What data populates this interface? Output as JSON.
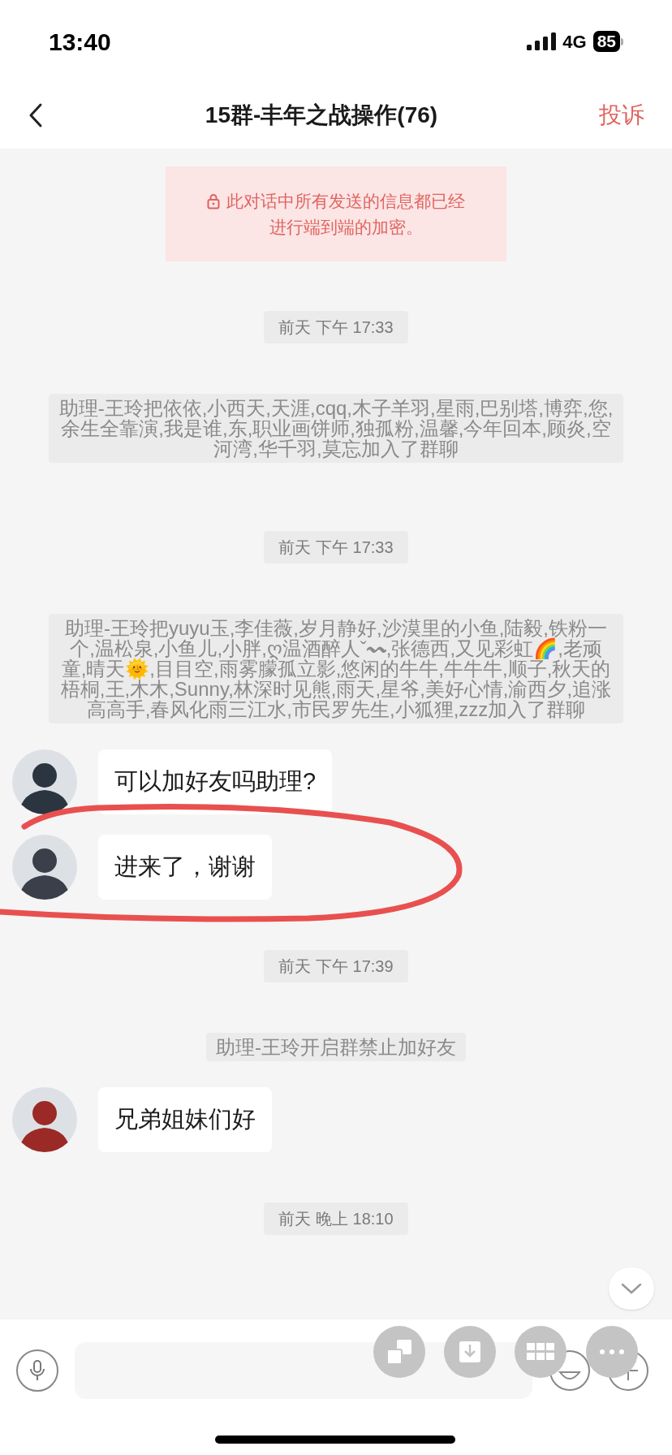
{
  "status_bar": {
    "time": "13:40",
    "network": "4G",
    "battery": "85"
  },
  "header": {
    "title": "15群-丰年之战操作(76)",
    "action": "投诉"
  },
  "messages": [
    {
      "kind": "notice",
      "lines": [
        "此对话中所有发送的信息都已经",
        "进行端到端的加密。"
      ]
    },
    {
      "kind": "timestamp",
      "text": "前天 下午 17:33"
    },
    {
      "kind": "system",
      "text": "助理-王玲把依依,小西天,天涯,cqq,木子羊羽,星雨,巴别塔,博弈,您,余生全靠演,我是谁,东,职业画饼师,独孤粉,温馨,今年回本,顾炎,空河湾,华千羽,莫忘加入了群聊"
    },
    {
      "kind": "timestamp",
      "text": "前天 下午 17:33"
    },
    {
      "kind": "system",
      "text": "助理-王玲把yuyu玉,李佳薇,岁月静好,沙漠里的小鱼,陆毅,铁粉一个,温松泉,小鱼儿,小胖,ღ温酒醉人ˇ〰,张德西,又见彩虹🌈,老顽童,晴天🌞,目目空,雨雾朦孤立影,悠闲的牛牛,牛牛牛,顺子,秋天的梧桐,王,木木,Sunny,林深时见熊,雨天,星爷,美好心情,渝西夕,追涨高高手,春风化雨三江水,市民罗先生,小狐狸,zzz加入了群聊"
    },
    {
      "kind": "message",
      "text": "可以加好友吗助理?",
      "color": "#2b3540"
    },
    {
      "kind": "message",
      "text": "进来了，谢谢",
      "color": "#3a3f4a"
    },
    {
      "kind": "timestamp",
      "text": "前天 下午 17:39"
    },
    {
      "kind": "system",
      "text": "助理-王玲开启群禁止加好友"
    },
    {
      "kind": "message",
      "text": "兄弟姐妹们好",
      "color": "#9b2a26"
    },
    {
      "kind": "timestamp",
      "text": "前天 晚上 18:10"
    }
  ]
}
